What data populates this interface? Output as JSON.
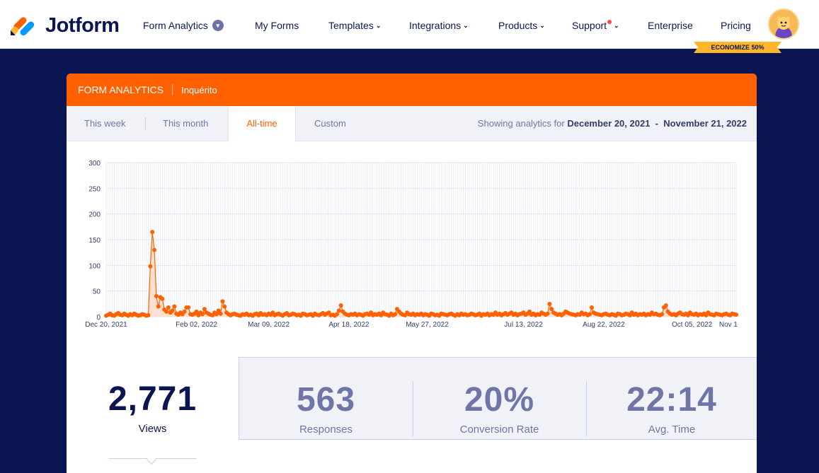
{
  "brand": {
    "name": "Jotform"
  },
  "nav": {
    "form_analytics": "Form Analytics",
    "my_forms": "My Forms",
    "templates": "Templates",
    "integrations": "Integrations",
    "products": "Products",
    "support": "Support",
    "enterprise": "Enterprise",
    "pricing": "Pricing",
    "promo": "ECONOMIZE 50%"
  },
  "panel": {
    "title": "FORM ANALYTICS",
    "form_name": "Inquérito",
    "tabs": [
      "This week",
      "This month",
      "All-time",
      "Custom"
    ],
    "active_tab": "All-time",
    "showing_prefix": "Showing analytics for",
    "date_range": "December 20, 2021  -  November 21, 2022"
  },
  "colors": {
    "accent": "#ff6100",
    "navy": "#0a1551",
    "muted": "#6f76a7",
    "light_bg": "#f1f2f8"
  },
  "chart_data": {
    "type": "line",
    "ylim": [
      0,
      300
    ],
    "yticks": [
      0,
      50,
      100,
      150,
      200,
      250,
      300
    ],
    "xtick_labels": [
      "Dec 20, 2021",
      "Feb 02, 2022",
      "Mar 09, 2022",
      "Apr 18, 2022",
      "May 27, 2022",
      "Jul 13, 2022",
      "Aug 22, 2022",
      "Oct 05, 2022",
      "Nov 1"
    ],
    "series": [
      {
        "values": [
          2,
          4,
          6,
          3,
          2,
          5,
          7,
          4,
          3,
          6,
          4,
          2,
          5,
          3,
          6,
          4,
          2,
          3,
          5,
          4,
          2,
          3,
          98,
          165,
          130,
          40,
          20,
          38,
          35,
          14,
          10,
          18,
          8,
          12,
          20,
          6,
          4,
          8,
          5,
          10,
          18,
          18,
          5,
          4,
          6,
          10,
          3,
          8,
          5,
          15,
          8,
          6,
          4,
          3,
          8,
          5,
          12,
          6,
          30,
          20,
          8,
          5,
          3,
          5,
          6,
          4,
          3,
          2,
          5,
          4,
          6,
          3,
          4,
          2,
          5,
          6,
          3,
          7,
          4,
          5,
          3,
          6,
          4,
          8,
          3,
          5,
          6,
          4,
          2,
          5,
          7,
          3,
          4,
          6,
          5,
          3,
          4,
          2,
          6,
          5,
          3,
          4,
          5,
          2,
          6,
          4,
          3,
          5,
          7,
          4,
          6,
          8,
          3,
          4,
          2,
          5,
          12,
          22,
          10,
          6,
          4,
          3,
          5,
          4,
          6,
          3,
          5,
          4,
          2,
          5,
          6,
          4,
          8,
          3,
          5,
          4,
          6,
          3,
          8,
          5,
          4,
          2,
          6,
          3,
          5,
          15,
          10,
          6,
          4,
          3,
          8,
          5,
          4,
          6,
          3,
          5,
          4,
          6,
          3,
          5,
          4,
          2,
          6,
          5,
          3,
          4,
          2,
          6,
          5,
          4,
          3,
          5,
          6,
          4,
          2,
          5,
          3,
          6,
          4,
          5,
          3,
          4,
          6,
          5,
          3,
          4,
          6,
          2,
          5,
          4,
          6,
          3,
          5,
          4,
          8,
          4,
          6,
          3,
          5,
          7,
          4,
          6,
          8,
          4,
          6,
          3,
          5,
          6,
          8,
          4,
          6,
          10,
          4,
          6,
          3,
          5,
          4,
          8,
          6,
          4,
          6,
          25,
          15,
          8,
          6,
          4,
          5,
          3,
          6,
          10,
          8,
          6,
          5,
          4,
          3,
          5,
          4,
          8,
          5,
          6,
          3,
          5,
          18,
          8,
          6,
          5,
          4,
          3,
          5,
          6,
          4,
          3,
          5,
          4,
          2,
          6,
          5,
          3,
          4,
          6,
          5,
          3,
          8,
          4,
          6,
          3,
          5,
          4,
          6,
          3,
          5,
          4,
          8,
          5,
          6,
          4,
          3,
          5,
          18,
          22,
          10,
          6,
          4,
          5,
          3,
          6,
          8,
          5,
          4,
          6,
          3,
          8,
          5,
          4,
          6,
          3,
          5,
          4,
          6,
          3,
          8,
          5,
          4,
          3,
          6,
          5,
          4,
          3,
          5,
          6,
          4,
          3,
          6,
          5,
          4
        ]
      }
    ]
  },
  "stats": [
    {
      "value": "2,771",
      "label": "Views"
    },
    {
      "value": "563",
      "label": "Responses"
    },
    {
      "value": "20%",
      "label": "Conversion Rate"
    },
    {
      "value": "22:14",
      "label": "Avg. Time"
    }
  ]
}
